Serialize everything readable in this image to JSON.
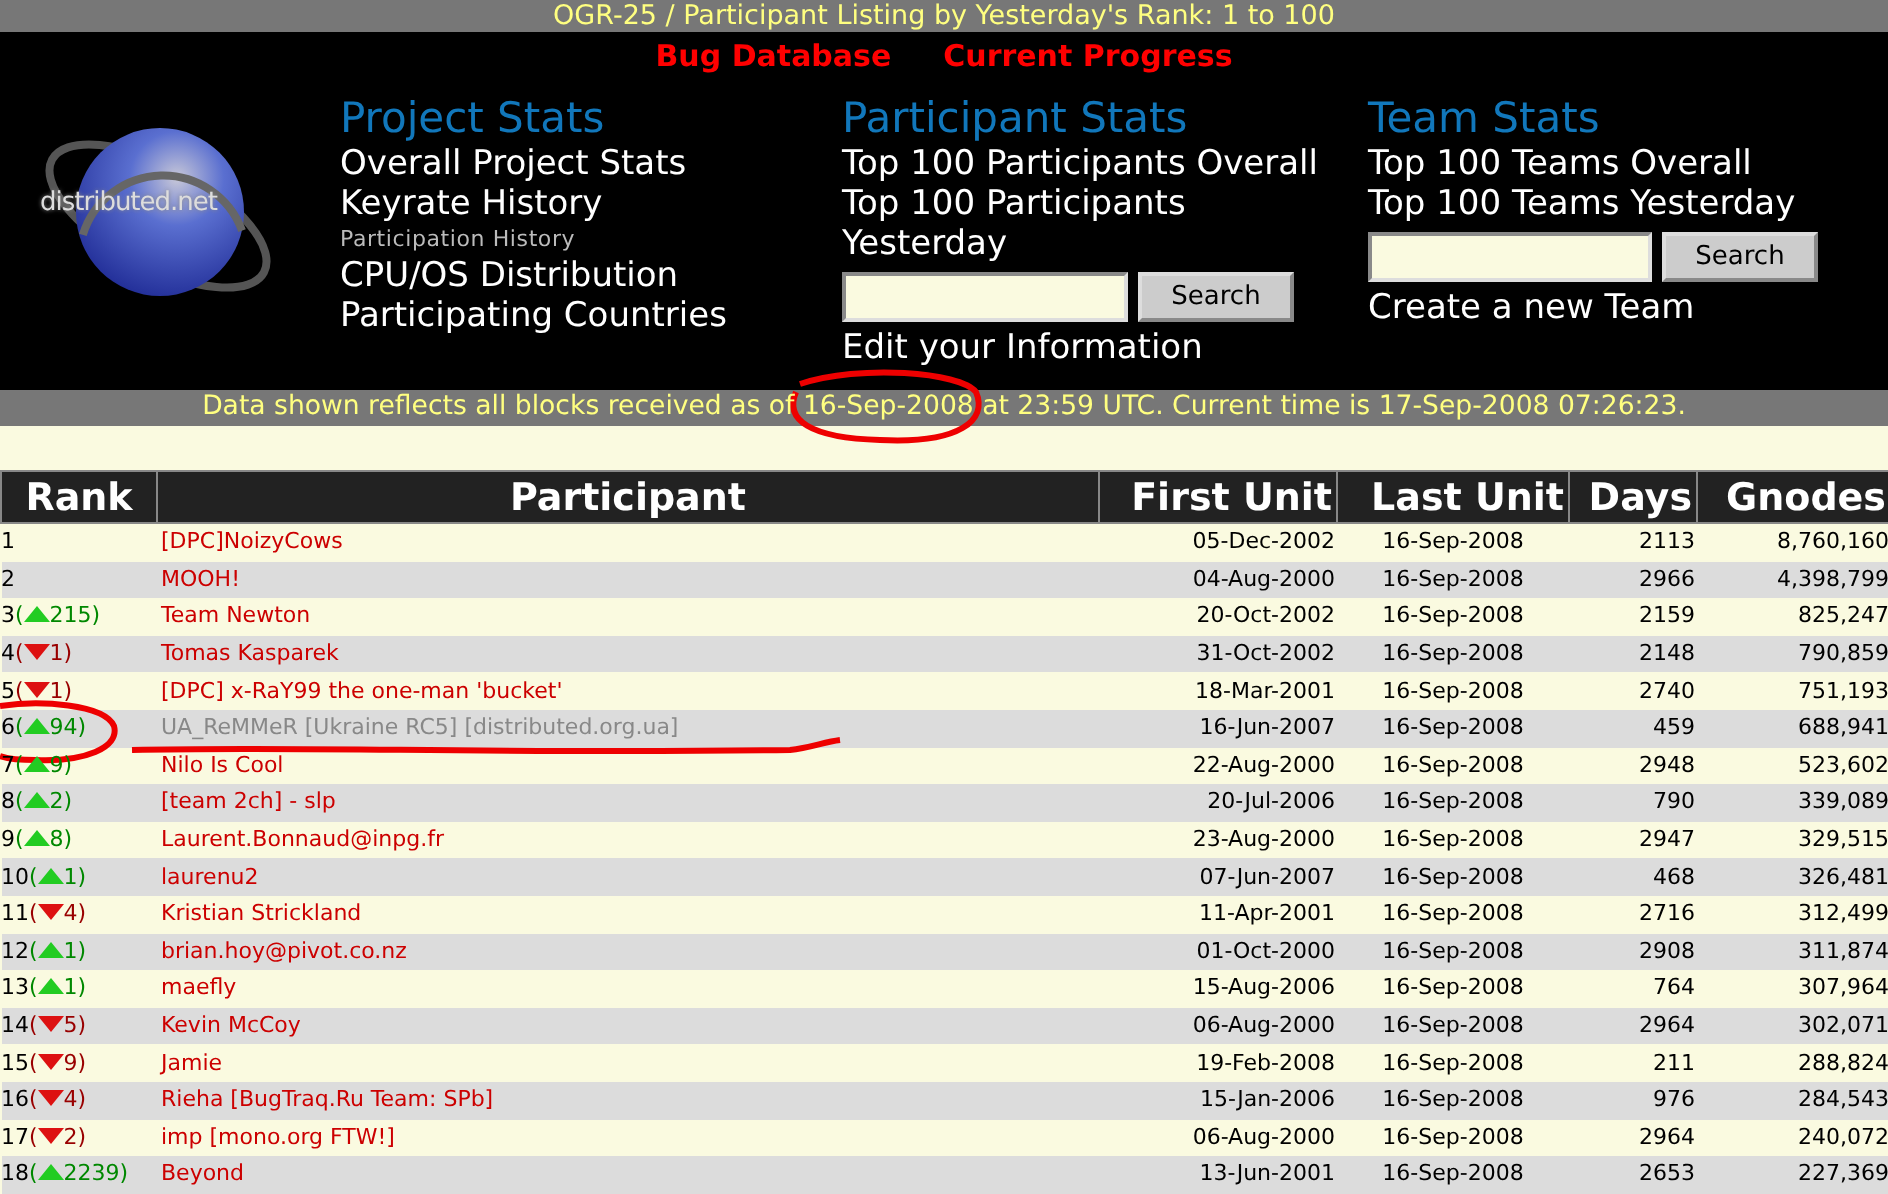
{
  "title_bar": "OGR-25 / Participant Listing by Yesterday's Rank: 1 to 100",
  "top_links": [
    "Bug Database",
    "Current Progress"
  ],
  "logo_text": "distributed.net",
  "sections": [
    {
      "heading": "Project Stats",
      "links": [
        {
          "label": "Overall Project Stats",
          "kind": "main"
        },
        {
          "label": "Keyrate History",
          "kind": "main"
        },
        {
          "label": "Participation History",
          "kind": "minor"
        },
        {
          "label": "CPU/OS Distribution",
          "kind": "main"
        },
        {
          "label": "Participating Countries",
          "kind": "main"
        }
      ]
    },
    {
      "heading": "Participant Stats",
      "links": [
        {
          "label": "Top 100 Participants Overall",
          "kind": "main"
        },
        {
          "label": "Top 100 Participants Yesterday",
          "kind": "main"
        }
      ],
      "search_button": "Search",
      "after_links": [
        "Edit your Information"
      ]
    },
    {
      "heading": "Team Stats",
      "links": [
        {
          "label": "Top 100 Teams Overall",
          "kind": "main"
        },
        {
          "label": "Top 100 Teams Yesterday",
          "kind": "main"
        }
      ],
      "search_button": "Search",
      "after_links": [
        "Create a new Team"
      ]
    }
  ],
  "status_bar": "Data shown reflects all blocks received as of 16-Sep-2008 at 23:59 UTC. Current time is 17-Sep-2008 07:26:23.",
  "table": {
    "columns": [
      "Rank",
      "Participant",
      "First Unit",
      "Last Unit",
      "Days",
      "Gnodes"
    ],
    "rows": [
      {
        "rank": "1",
        "kind": "none",
        "participant": "[DPC]NoizyCows",
        "muted": false,
        "first": "05-Dec-2002",
        "last": "16-Sep-2008",
        "days": "2113",
        "gnodes": "8,760,160"
      },
      {
        "rank": "2",
        "kind": "none",
        "participant": "MOOH!",
        "muted": false,
        "first": "04-Aug-2000",
        "last": "16-Sep-2008",
        "days": "2966",
        "gnodes": "4,398,799"
      },
      {
        "rank": "3",
        "kind": "up",
        "open": "(",
        "change": "215",
        "close": ")",
        "participant": "Team Newton",
        "muted": false,
        "first": "20-Oct-2002",
        "last": "16-Sep-2008",
        "days": "2159",
        "gnodes": "825,247"
      },
      {
        "rank": "4",
        "kind": "down",
        "open": "(",
        "change": "1",
        "close": ")",
        "participant": "Tomas Kasparek",
        "muted": false,
        "first": "31-Oct-2002",
        "last": "16-Sep-2008",
        "days": "2148",
        "gnodes": "790,859"
      },
      {
        "rank": "5",
        "kind": "down",
        "open": "(",
        "change": "1",
        "close": ")",
        "participant": "[DPC] x-RaY99 the one-man 'bucket'",
        "muted": false,
        "first": "18-Mar-2001",
        "last": "16-Sep-2008",
        "days": "2740",
        "gnodes": "751,193"
      },
      {
        "rank": "6",
        "kind": "up",
        "open": "(",
        "change": "94",
        "close": ")",
        "participant": "UA_ReMMeR [Ukraine RC5] [distributed.org.ua]",
        "muted": true,
        "first": "16-Jun-2007",
        "last": "16-Sep-2008",
        "days": "459",
        "gnodes": "688,941"
      },
      {
        "rank": "7",
        "kind": "up",
        "open": "(",
        "change": "9",
        "close": ")",
        "participant": "Nilo Is Cool",
        "muted": false,
        "first": "22-Aug-2000",
        "last": "16-Sep-2008",
        "days": "2948",
        "gnodes": "523,602"
      },
      {
        "rank": "8",
        "kind": "up",
        "open": "(",
        "change": "2",
        "close": ")",
        "participant": "[team 2ch] - slp",
        "muted": false,
        "first": "20-Jul-2006",
        "last": "16-Sep-2008",
        "days": "790",
        "gnodes": "339,089"
      },
      {
        "rank": "9",
        "kind": "up",
        "open": "(",
        "change": "8",
        "close": ")",
        "participant": "Laurent.Bonnaud@inpg.fr",
        "muted": false,
        "first": "23-Aug-2000",
        "last": "16-Sep-2008",
        "days": "2947",
        "gnodes": "329,515"
      },
      {
        "rank": "10",
        "kind": "up",
        "open": "(",
        "change": "1",
        "close": ")",
        "participant": "laurenu2",
        "muted": false,
        "first": "07-Jun-2007",
        "last": "16-Sep-2008",
        "days": "468",
        "gnodes": "326,481"
      },
      {
        "rank": "11",
        "kind": "down",
        "open": "(",
        "change": "4",
        "close": ")",
        "participant": "Kristian Strickland",
        "muted": false,
        "first": "11-Apr-2001",
        "last": "16-Sep-2008",
        "days": "2716",
        "gnodes": "312,499"
      },
      {
        "rank": "12",
        "kind": "up",
        "open": "(",
        "change": "1",
        "close": ")",
        "participant": "brian.hoy@pivot.co.nz",
        "muted": false,
        "first": "01-Oct-2000",
        "last": "16-Sep-2008",
        "days": "2908",
        "gnodes": "311,874"
      },
      {
        "rank": "13",
        "kind": "up",
        "open": "(",
        "change": "1",
        "close": ")",
        "participant": "maefly",
        "muted": false,
        "first": "15-Aug-2006",
        "last": "16-Sep-2008",
        "days": "764",
        "gnodes": "307,964"
      },
      {
        "rank": "14",
        "kind": "down",
        "open": "(",
        "change": "5",
        "close": ")",
        "participant": "Kevin McCoy",
        "muted": false,
        "first": "06-Aug-2000",
        "last": "16-Sep-2008",
        "days": "2964",
        "gnodes": "302,071"
      },
      {
        "rank": "15",
        "kind": "down",
        "open": "(",
        "change": "9",
        "close": ")",
        "participant": "Jamie",
        "muted": false,
        "first": "19-Feb-2008",
        "last": "16-Sep-2008",
        "days": "211",
        "gnodes": "288,824"
      },
      {
        "rank": "16",
        "kind": "down",
        "open": "(",
        "change": "4",
        "close": ")",
        "participant": "Rieha [BugTraq.Ru Team: SPb]",
        "muted": false,
        "first": "15-Jan-2006",
        "last": "16-Sep-2008",
        "days": "976",
        "gnodes": "284,543"
      },
      {
        "rank": "17",
        "kind": "down",
        "open": "(",
        "change": "2",
        "close": ")",
        "participant": "imp [mono.org FTW!]",
        "muted": false,
        "first": "06-Aug-2000",
        "last": "16-Sep-2008",
        "days": "2964",
        "gnodes": "240,072"
      },
      {
        "rank": "18",
        "kind": "up",
        "open": "(",
        "change": "2239",
        "close": ")",
        "participant": "Beyond",
        "muted": false,
        "first": "13-Jun-2001",
        "last": "16-Sep-2008",
        "days": "2653",
        "gnodes": "227,369"
      }
    ]
  }
}
